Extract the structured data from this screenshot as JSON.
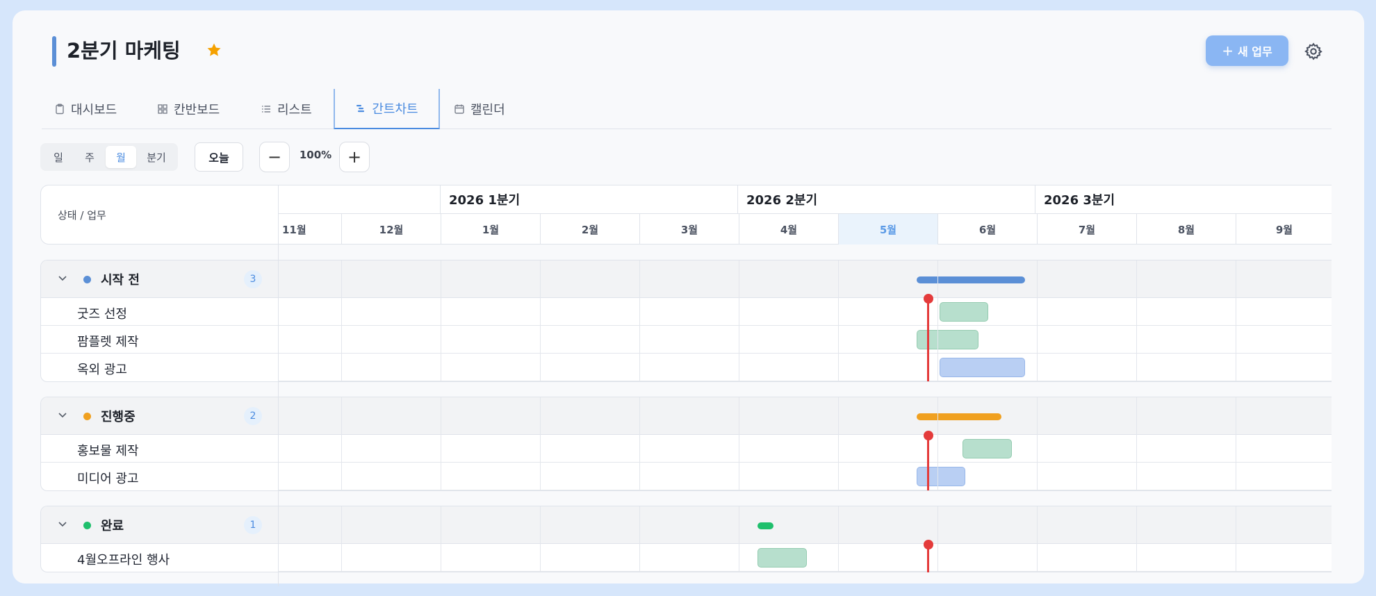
{
  "project": {
    "title": "2분기 마케팅",
    "new_task_label": "새 업무"
  },
  "tabs": [
    {
      "label": "대시보드",
      "icon": "clipboard-icon"
    },
    {
      "label": "칸반보드",
      "icon": "grid-icon"
    },
    {
      "label": "리스트",
      "icon": "list-icon"
    },
    {
      "label": "간트차트",
      "icon": "gantt-icon",
      "active": true
    },
    {
      "label": "캘린더",
      "icon": "calendar-icon"
    }
  ],
  "scale": {
    "options": [
      "일",
      "주",
      "월",
      "분기"
    ],
    "selected": "월"
  },
  "toolbar": {
    "today_label": "오늘",
    "zoom": "100%",
    "zoom_out": "−",
    "zoom_in": "+"
  },
  "grid": {
    "left_header": "상태 / 업무",
    "quarters": [
      "2026 1분기",
      "2026 2분기",
      "2026 3분기"
    ],
    "months": [
      "11월",
      "12월",
      "1월",
      "2월",
      "3월",
      "4월",
      "5월",
      "6월",
      "7월",
      "8월",
      "9월"
    ],
    "current_month": "5월"
  },
  "groups": [
    {
      "name": "시작 전",
      "count": "3",
      "color": "#5b8fd6",
      "tasks": [
        "굿즈 선정",
        "팜플렛 제작",
        "옥외 광고"
      ]
    },
    {
      "name": "진행중",
      "count": "2",
      "color": "#f0a020",
      "tasks": [
        "홍보물 제작",
        "미디어 광고"
      ]
    },
    {
      "name": "완료",
      "count": "1",
      "color": "#1fbf6c",
      "tasks": [
        "4월오프라인 행사"
      ]
    }
  ],
  "colors": {
    "accent": "#4a8be0",
    "today": "#e43b3b",
    "bar_green": "#b7dfcd",
    "bar_blue": "#b9cff3"
  }
}
